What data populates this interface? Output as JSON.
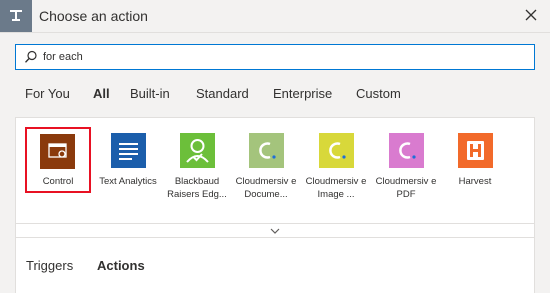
{
  "header": {
    "title": "Choose an action"
  },
  "search": {
    "value": "for each"
  },
  "tabs": [
    {
      "label": "For You"
    },
    {
      "label": "All"
    },
    {
      "label": "Built-in"
    },
    {
      "label": "Standard"
    },
    {
      "label": "Enterprise"
    },
    {
      "label": "Custom"
    }
  ],
  "connectors": [
    {
      "label": "Control",
      "color": "#8a3a0c"
    },
    {
      "label": "Text Analytics",
      "color": "#1b5eab"
    },
    {
      "label": "Blackbaud Raisers Edg...",
      "color": "#6cbf3a"
    },
    {
      "label": "Cloudmersiv e Docume...",
      "color": "#a4c47c"
    },
    {
      "label": "Cloudmersiv e Image ...",
      "color": "#d8d83a"
    },
    {
      "label": "Cloudmersiv e PDF",
      "color": "#d97bcf"
    },
    {
      "label": "Harvest",
      "color": "#f26a2a"
    }
  ],
  "bottom_tabs": [
    {
      "label": "Triggers"
    },
    {
      "label": "Actions"
    }
  ]
}
